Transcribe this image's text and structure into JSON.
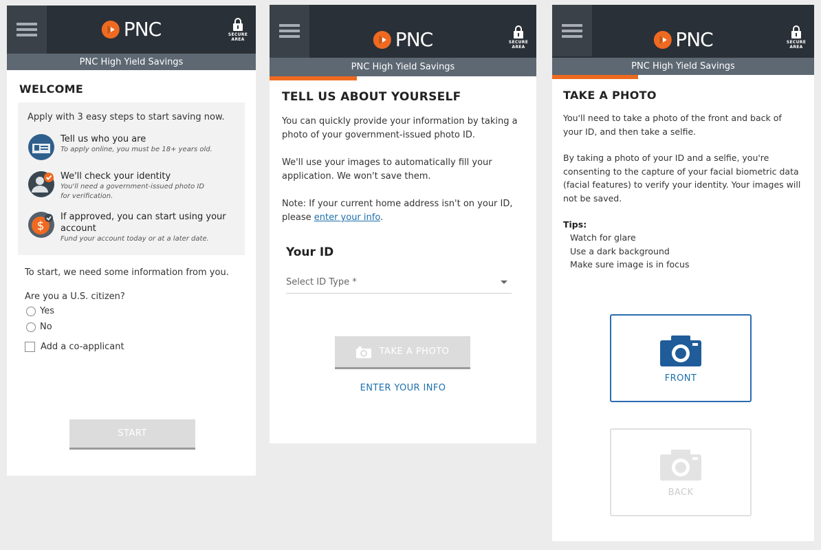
{
  "header": {
    "brand": "PNC",
    "secure_label_line1": "SECURE",
    "secure_label_line2": "AREA",
    "product": "PNC High Yield Savings",
    "brand_color": "#ef6a20",
    "bar_color": "#2a3037"
  },
  "welcome": {
    "title": "WELCOME",
    "intro": "Apply with 3 easy steps to start saving now.",
    "steps": [
      {
        "icon": "id-card-icon",
        "title": "Tell us who you are",
        "sub": "To apply online, you must be 18+ years old."
      },
      {
        "icon": "user-check-icon",
        "title": "We'll check your identity",
        "sub1": "You'll need a government-issued photo ID",
        "sub2": "for verification."
      },
      {
        "icon": "dollar-coin-icon",
        "title1": "If approved, you can start using your",
        "title2": "account",
        "sub": "Fund your account today or at a later date."
      }
    ],
    "info_line": "To start, we need some information from you.",
    "citizen_question": "Are you a U.S. citizen?",
    "option_yes": "Yes",
    "option_no": "No",
    "coapplicant_label": "Add a co-applicant",
    "start_button": "START"
  },
  "about": {
    "title": "TELL US ABOUT YOURSELF",
    "para1": "You can quickly provide your information by taking a photo of your government-issued photo ID.",
    "para2": "We'll use your images to automatically fill your application. We won't save them.",
    "para3_prefix": "Note: If your current home address isn't on your ID, please ",
    "para3_link": "enter your info",
    "para3_suffix": ".",
    "your_id_heading": "Your ID",
    "select_placeholder": "Select ID Type *",
    "take_photo_button": "TAKE A PHOTO",
    "enter_info_link": "ENTER YOUR INFO"
  },
  "photo": {
    "title": "TAKE A PHOTO",
    "para1": "You'll need to take a photo of the front and back of your ID, and then take a selfie.",
    "para2": "By taking a photo of your ID and a selfie, you're consenting to the capture of your facial biometric data (facial features) to verify your identity. Your images will not be saved.",
    "tips_title": "Tips:",
    "tips": [
      "Watch for glare",
      "Use a dark background",
      "Make sure image is in focus"
    ],
    "front_label": "FRONT",
    "back_label": "BACK"
  }
}
